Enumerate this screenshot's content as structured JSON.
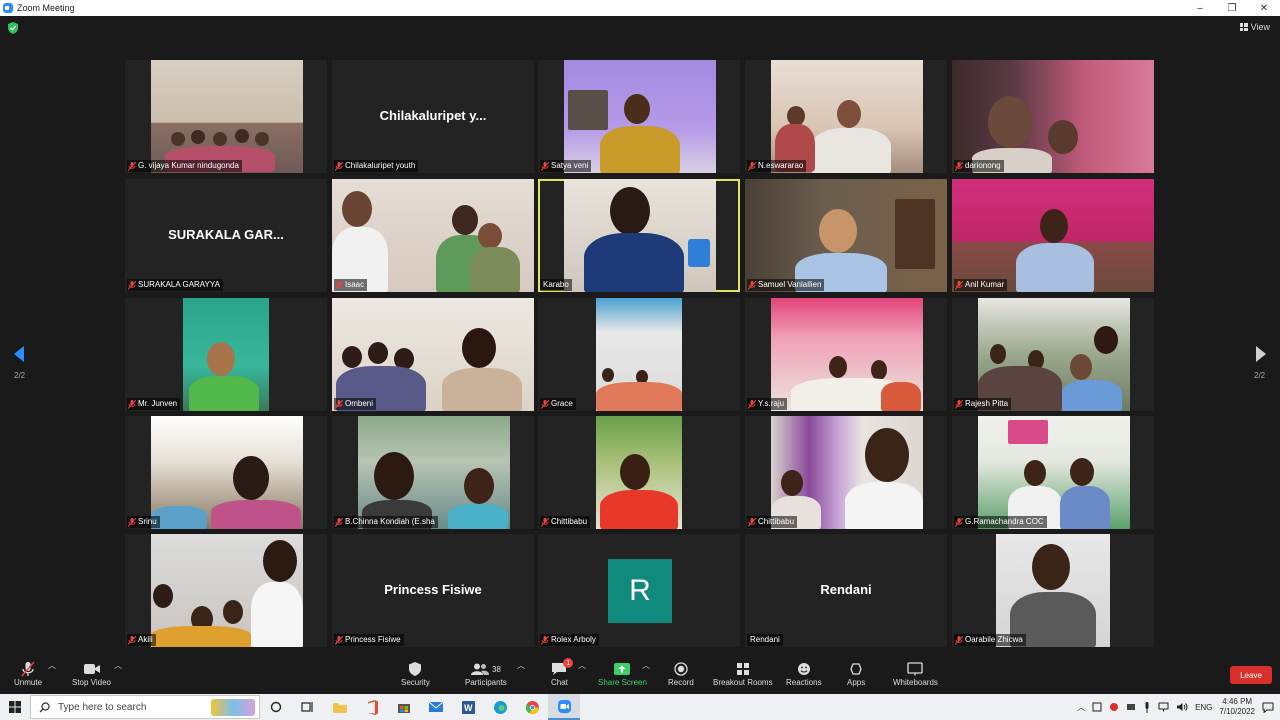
{
  "window": {
    "title": "Zoom Meeting",
    "minimize": "–",
    "maximize": "❐",
    "close": "✕"
  },
  "view_label": "View",
  "page_indicator": "2/2",
  "participants": [
    {
      "name": "G. vijaya Kumar nindugonda",
      "muted": true,
      "type": "video"
    },
    {
      "name": "Chilakaluripet youth",
      "muted": true,
      "type": "name",
      "display": "Chilakaluripet  y..."
    },
    {
      "name": "Satya veni",
      "muted": true,
      "type": "video"
    },
    {
      "name": "N.eswararao",
      "muted": true,
      "type": "video"
    },
    {
      "name": "darionong",
      "muted": true,
      "type": "video"
    },
    {
      "name": "SURAKALA GARAYYA",
      "muted": true,
      "type": "name",
      "display": "SURAKALA  GAR..."
    },
    {
      "name": "Isaac",
      "muted": true,
      "type": "video"
    },
    {
      "name": "Karabo",
      "muted": false,
      "type": "video",
      "active": true
    },
    {
      "name": "Samuel Vanlallien",
      "muted": true,
      "type": "video"
    },
    {
      "name": "Anil Kumar",
      "muted": true,
      "type": "video"
    },
    {
      "name": "Mr. Junven",
      "muted": true,
      "type": "video"
    },
    {
      "name": "Ombeni",
      "muted": true,
      "type": "video"
    },
    {
      "name": "Grace",
      "muted": true,
      "type": "video"
    },
    {
      "name": "Y.s.raju",
      "muted": true,
      "type": "video"
    },
    {
      "name": "Rajesh Pitta",
      "muted": true,
      "type": "video"
    },
    {
      "name": "Srinu",
      "muted": true,
      "type": "video"
    },
    {
      "name": "B.Chinna Kondiah (E.sha",
      "muted": true,
      "type": "video"
    },
    {
      "name": "Chittibabu",
      "muted": true,
      "type": "video"
    },
    {
      "name": "Chittibabu",
      "muted": true,
      "type": "video"
    },
    {
      "name": "G.Ramachandra COC",
      "muted": true,
      "type": "video"
    },
    {
      "name": "Akili",
      "muted": true,
      "type": "video"
    },
    {
      "name": "Princess Fisiwe",
      "muted": true,
      "type": "name",
      "display": "Princess Fisiwe"
    },
    {
      "name": "Rolex Arboly",
      "muted": true,
      "type": "avatar",
      "initial": "R"
    },
    {
      "name": "Rendani",
      "muted": false,
      "type": "name",
      "display": "Rendani"
    },
    {
      "name": "Oarabile Zhicwa",
      "muted": true,
      "type": "video"
    }
  ],
  "toolbar": {
    "unmute": "Unmute",
    "stop_video": "Stop Video",
    "security": "Security",
    "participants": "Participants",
    "participants_count": "38",
    "chat": "Chat",
    "chat_badge": "1",
    "share_screen": "Share Screen",
    "record": "Record",
    "breakout_rooms": "Breakout Rooms",
    "reactions": "Reactions",
    "apps": "Apps",
    "whiteboards": "Whiteboards",
    "leave": "Leave"
  },
  "taskbar": {
    "search_placeholder": "Type here to search",
    "language": "ENG",
    "time": "4:46 PM",
    "date": "7/10/2022"
  },
  "colors": {
    "background": "#1a1a1a",
    "tile": "#232323",
    "active_speaker": "#e4e458",
    "avatar": "#118a7e",
    "leave": "#d9302c",
    "share_green": "#3fcf6a"
  }
}
